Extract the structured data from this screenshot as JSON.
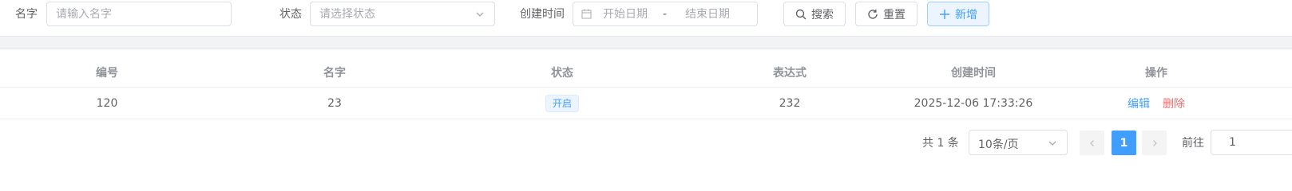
{
  "search_form": {
    "name_label": "名字",
    "name_placeholder": "请输入名字",
    "status_label": "状态",
    "status_placeholder": "请选择状态",
    "created_label": "创建时间",
    "start_placeholder": "开始日期",
    "range_separator": "-",
    "end_placeholder": "结束日期",
    "search_button": "搜索",
    "reset_button": "重置",
    "add_button": "新增"
  },
  "table": {
    "headers": [
      "编号",
      "名字",
      "状态",
      "表达式",
      "创建时间",
      "操作"
    ],
    "rows": [
      {
        "id": "120",
        "name": "23",
        "status": "开启",
        "expression": "232",
        "created_at": "2025-12-06 17:33:26",
        "edit": "编辑",
        "delete": "删除"
      }
    ]
  },
  "pagination": {
    "total": "共 1 条",
    "page_size": "10条/页",
    "current_page": "1",
    "goto_label": "前往",
    "goto_value": "1"
  },
  "colors": {
    "primary": "#409eff",
    "danger": "#f56c6c",
    "border": "#dcdfe6"
  }
}
